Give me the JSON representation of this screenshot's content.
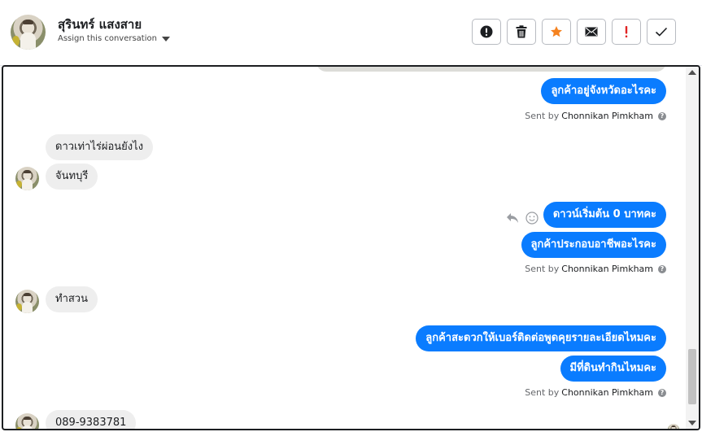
{
  "header": {
    "contact_name": "สุรินทร์ แสงสาย",
    "assign_label": "Assign this conversation"
  },
  "toolbar": {
    "buttons": [
      {
        "name": "alert-circle",
        "icon": "exclamation-circle-icon"
      },
      {
        "name": "delete",
        "icon": "trash-icon"
      },
      {
        "name": "star",
        "icon": "star-icon",
        "color": "#f5821f"
      },
      {
        "name": "mail",
        "icon": "envelope-icon"
      },
      {
        "name": "important",
        "icon": "exclamation-icon",
        "color": "#e02424"
      },
      {
        "name": "done",
        "icon": "check-icon"
      }
    ]
  },
  "messages": [
    {
      "dir": "out",
      "text": "ลูกค้าอยู่จังหวัดอะไรคะ"
    },
    {
      "dir": "in",
      "text": "ดาวเท่าไร่ผ่อนยังไง"
    },
    {
      "dir": "in",
      "text": "จันทบุรี"
    },
    {
      "dir": "out",
      "text": "ดาวน์เริ่มต้น 0 บาทคะ"
    },
    {
      "dir": "out",
      "text": "ลูกค้าประกอบอาชีพอะไรคะ"
    },
    {
      "dir": "in",
      "text": "ทำสวน"
    },
    {
      "dir": "out",
      "text": "ลูกค้าสะดวกให้เบอร์ติดต่อพูดคุยรายละเอียดไหมคะ"
    },
    {
      "dir": "out",
      "text": "มีที่ดินทำกินไหมคะ"
    },
    {
      "dir": "in",
      "text": "089-9383781"
    }
  ],
  "sent_by": {
    "prefix": "Sent by",
    "agent": "Chonnikan Pimkham"
  },
  "colors": {
    "outgoing_bubble": "#0a7cff",
    "incoming_bubble": "#eeeeee",
    "panel_border": "#1c1e21"
  }
}
